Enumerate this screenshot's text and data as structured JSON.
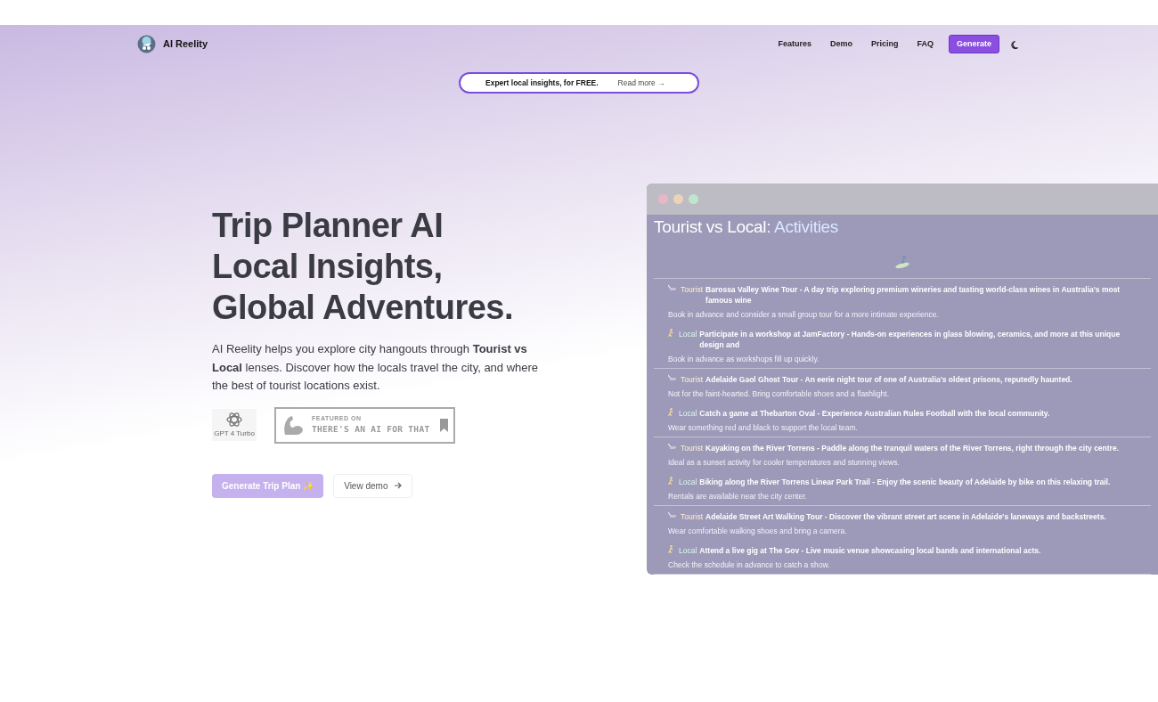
{
  "brand": {
    "name": "AI Reelity"
  },
  "nav": [
    {
      "label": "Features"
    },
    {
      "label": "Demo"
    },
    {
      "label": "Pricing"
    },
    {
      "label": "FAQ"
    }
  ],
  "nav_button": "Generate",
  "announcement": {
    "text": "Expert local insights, for FREE.",
    "link": "Read more →"
  },
  "hero": {
    "title_lines": [
      "Trip Planner AI",
      "Local Insights,",
      "Global Adventures."
    ],
    "description": "AI Reelity helps you explore city hangouts through **Tourist vs Local** lenses. Discover how the locals travel the city, and where the best of tourist locations exist.",
    "model_badge": "GPT 4 Turbo",
    "featured_badge": {
      "small": "FEATURED ON",
      "big": "THERE'S AN AI FOR THAT"
    },
    "primary_button": "Generate Trip Plan ✨",
    "secondary_button": "View demo"
  },
  "preview": {
    "title": "Tourist vs Local:",
    "title_highlight": "Activities",
    "items": [
      {
        "kind": "tourist",
        "tag": "Tourist",
        "text": "Barossa Valley Wine Tour - A day trip exploring premium wineries and tasting world-class wines in Australia's most famous wine",
        "tip": "Book in advance and consider a small group tour for a more intimate experience."
      },
      {
        "kind": "local",
        "tag": "Local",
        "text": "Participate in a workshop at JamFactory - Hands-on experiences in glass blowing, ceramics, and more at this unique design and",
        "tip": "Book in advance as workshops fill up quickly."
      },
      {
        "kind": "tourist",
        "tag": "Tourist",
        "text": "Adelaide Gaol Ghost Tour - An eerie night tour of one of Australia's oldest prisons, reputedly haunted.",
        "tip": "Not for the faint-hearted. Bring comfortable shoes and a flashlight."
      },
      {
        "kind": "local",
        "tag": "Local",
        "text": "Catch a game at Thebarton Oval - Experience Australian Rules Football with the local community.",
        "tip": "Wear something red and black to support the local team."
      },
      {
        "kind": "tourist",
        "tag": "Tourist",
        "text": "Kayaking on the River Torrens - Paddle along the tranquil waters of the River Torrens, right through the city centre.",
        "tip": "Ideal as a sunset activity for cooler temperatures and stunning views."
      },
      {
        "kind": "local",
        "tag": "Local",
        "text": "Biking along the River Torrens Linear Park Trail - Enjoy the scenic beauty of Adelaide by bike on this relaxing trail.",
        "tip": "Rentals are available near the city center."
      },
      {
        "kind": "tourist",
        "tag": "Tourist",
        "text": "Adelaide Street Art Walking Tour - Discover the vibrant street art scene in Adelaide's laneways and backstreets.",
        "tip": "Wear comfortable walking shoes and bring a camera."
      },
      {
        "kind": "local",
        "tag": "Local",
        "text": "Attend a live gig at The Gov - Live music venue showcasing local bands and international acts.",
        "tip": "Check the schedule in advance to catch a show."
      }
    ]
  }
}
